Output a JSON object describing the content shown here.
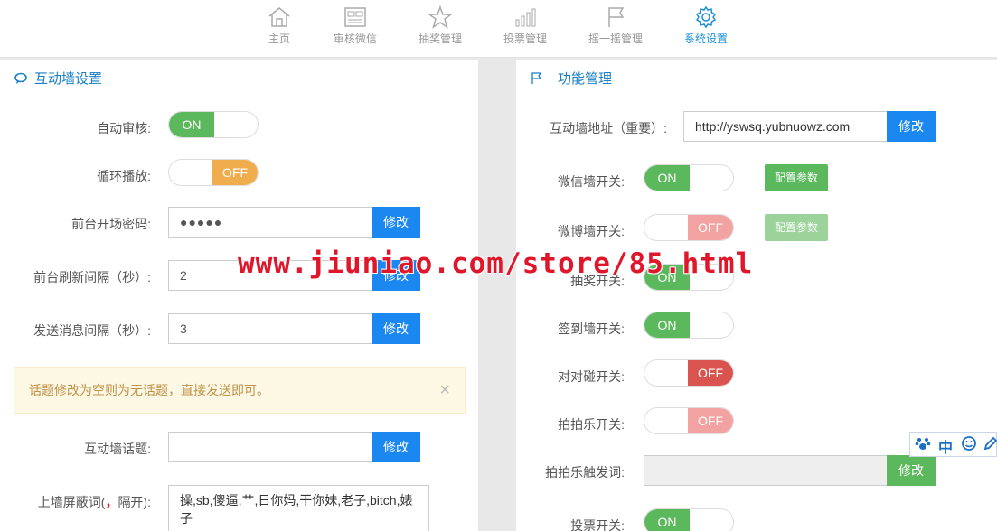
{
  "nav": {
    "items": [
      {
        "label": "主页",
        "icon": "home-icon"
      },
      {
        "label": "审核微信",
        "icon": "review-icon"
      },
      {
        "label": "抽奖管理",
        "icon": "star-icon"
      },
      {
        "label": "投票管理",
        "icon": "bar-chart-icon"
      },
      {
        "label": "摇一摇管理",
        "icon": "flag-icon"
      },
      {
        "label": "系统设置",
        "icon": "gear-icon"
      }
    ],
    "active": "系统设置",
    "active_color": "#1b8fd6"
  },
  "left": {
    "title": "互动墙设置",
    "auto_review": {
      "label": "自动审核:",
      "on": "ON"
    },
    "loop_play": {
      "label": "循环播放:",
      "off": "OFF"
    },
    "password": {
      "label": "前台开场密码:",
      "value": "●●●●●",
      "button": "修改"
    },
    "refresh": {
      "label": "前台刷新间隔（秒）:",
      "value": "2",
      "button": "修改"
    },
    "send_interval": {
      "label": "发送消息间隔（秒）:",
      "value": "3",
      "button": "修改"
    },
    "alert": {
      "text": "话题修改为空则为无话题，直接发送即可。",
      "close": "×"
    },
    "topic": {
      "label": "互动墙话题:",
      "value": "",
      "button": "修改"
    },
    "block_words": {
      "label_pre": "上墙屏蔽词(",
      "label_sep": "，",
      "label_post": "隔开):",
      "value": "操,sb,傻逼,艹,日你妈,干你妹,老子,bitch,婊子"
    }
  },
  "right": {
    "title": "功能管理",
    "wall_url": {
      "label": "互动墙地址（重要）:",
      "value": "http://yswsq.yubnuowz.com",
      "button": "修改"
    },
    "wechat_wall": {
      "label": "微信墙开关:",
      "on": "ON",
      "config": "配置参数"
    },
    "weibo_wall": {
      "label": "微博墙开关:",
      "off": "OFF",
      "config": "配置参数"
    },
    "lottery": {
      "label": "抽奖开关:",
      "on": "ON"
    },
    "signin": {
      "label": "签到墙开关:",
      "on": "ON"
    },
    "pair": {
      "label": "对对碰开关:",
      "off": "OFF"
    },
    "clap": {
      "label": "拍拍乐开关:",
      "off": "OFF"
    },
    "clap_word": {
      "label": "拍拍乐触发词:",
      "value": "",
      "button": "修改"
    },
    "vote": {
      "label": "投票开关:",
      "on": "ON"
    }
  },
  "watermark": "www.jiuniao.com/store/85.html",
  "ime": {
    "lang": "中",
    "icons": [
      "paw-icon",
      "smile-icon",
      "pen-icon"
    ]
  },
  "colors": {
    "on": "#5cb85c",
    "off_orange": "#f0ad4e",
    "off_red": "#d9534f",
    "button_blue": "#1b87f0",
    "title": "#1b7fc4"
  }
}
